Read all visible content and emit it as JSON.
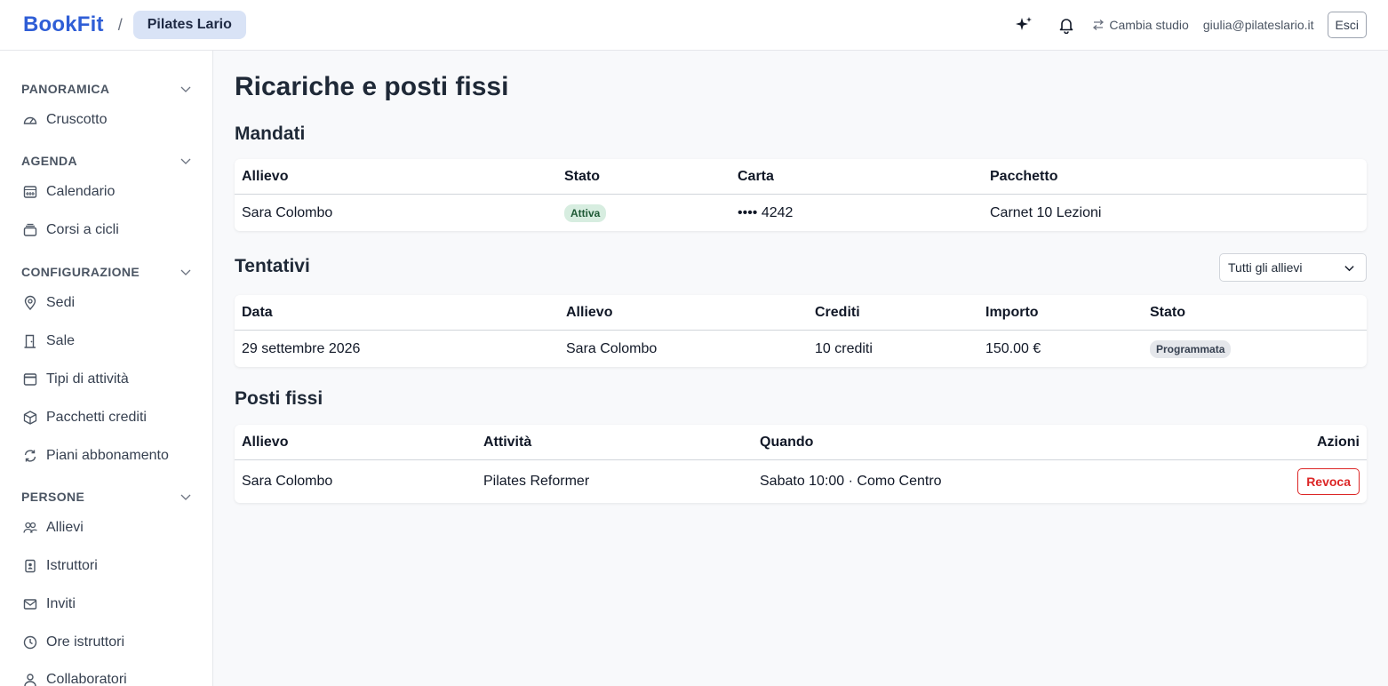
{
  "header": {
    "brand": "BookFit",
    "separator": "/",
    "studio": "Pilates Lario",
    "switch_label": "Cambia studio",
    "user_email": "giulia@pilateslario.it",
    "logout_label": "Esci"
  },
  "sidebar": {
    "sections": [
      {
        "title": "PANORAMICA",
        "items": [
          {
            "label": "Cruscotto",
            "icon": "gauge-icon"
          }
        ]
      },
      {
        "title": "AGENDA",
        "items": [
          {
            "label": "Calendario",
            "icon": "calendar-grid-icon"
          },
          {
            "label": "Corsi a cicli",
            "icon": "stack-icon"
          }
        ]
      },
      {
        "title": "CONFIGURAZIONE",
        "items": [
          {
            "label": "Sedi",
            "icon": "map-pin-icon"
          },
          {
            "label": "Sale",
            "icon": "door-icon"
          },
          {
            "label": "Tipi di attività",
            "icon": "calendar-icon"
          },
          {
            "label": "Pacchetti crediti",
            "icon": "package-icon"
          },
          {
            "label": "Piani abbonamento",
            "icon": "refresh-icon"
          }
        ]
      },
      {
        "title": "PERSONE",
        "items": [
          {
            "label": "Allievi",
            "icon": "users-icon"
          },
          {
            "label": "Istruttori",
            "icon": "id-badge-icon"
          },
          {
            "label": "Inviti",
            "icon": "mail-icon"
          },
          {
            "label": "Ore istruttori",
            "icon": "clock-icon"
          },
          {
            "label": "Collaboratori",
            "icon": "user-icon"
          }
        ]
      }
    ]
  },
  "main": {
    "title": "Ricariche e posti fissi",
    "mandati": {
      "title": "Mandati",
      "columns": [
        "Allievo",
        "Stato",
        "Carta",
        "Pacchetto"
      ],
      "rows": [
        {
          "allievo": "Sara Colombo",
          "stato": "Attiva",
          "carta": "•••• 4242",
          "pacchetto": "Carnet 10 Lezioni"
        }
      ]
    },
    "tentativi": {
      "title": "Tentativi",
      "filter": "Tutti gli allievi",
      "columns": [
        "Data",
        "Allievo",
        "Crediti",
        "Importo",
        "Stato"
      ],
      "rows": [
        {
          "data": "29 settembre 2026",
          "allievo": "Sara Colombo",
          "crediti": "10 crediti",
          "importo": "150.00 €",
          "stato": "Programmata"
        }
      ]
    },
    "posti_fissi": {
      "title": "Posti fissi",
      "columns": [
        "Allievo",
        "Attività",
        "Quando",
        "Azioni"
      ],
      "rows": [
        {
          "allievo": "Sara Colombo",
          "attivita": "Pilates Reformer",
          "quando": "Sabato 10:00 · Como Centro",
          "azione": "Revoca"
        }
      ]
    }
  },
  "colors": {
    "brand": "#2f5ed6",
    "pill": "#d9e3f6",
    "badge_active": "#d7ede0",
    "badge_scheduled": "#e5e7eb",
    "danger": "#dc2626"
  }
}
